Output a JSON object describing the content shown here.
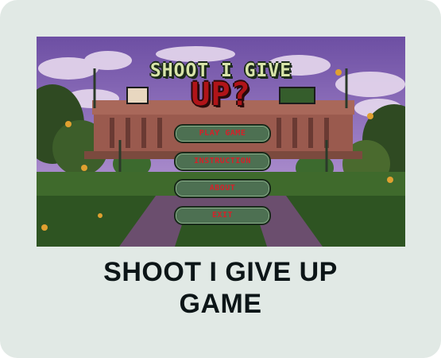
{
  "game": {
    "logo_line1": "SHOOT I GIVE",
    "logo_line2": "UP?",
    "menu": [
      {
        "label": "PLAY GAME"
      },
      {
        "label": "INSTRUCTION"
      },
      {
        "label": "ABOUT"
      },
      {
        "label": "EXIT"
      }
    ]
  },
  "caption": {
    "line1": "SHOOT I GIVE UP",
    "line2": "GAME"
  },
  "colors": {
    "card_background": "#e1e9e5",
    "button_fill": "#4d7052",
    "button_text": "#d3222a",
    "logo_red": "#b01418",
    "title_text": "#0c1517"
  }
}
